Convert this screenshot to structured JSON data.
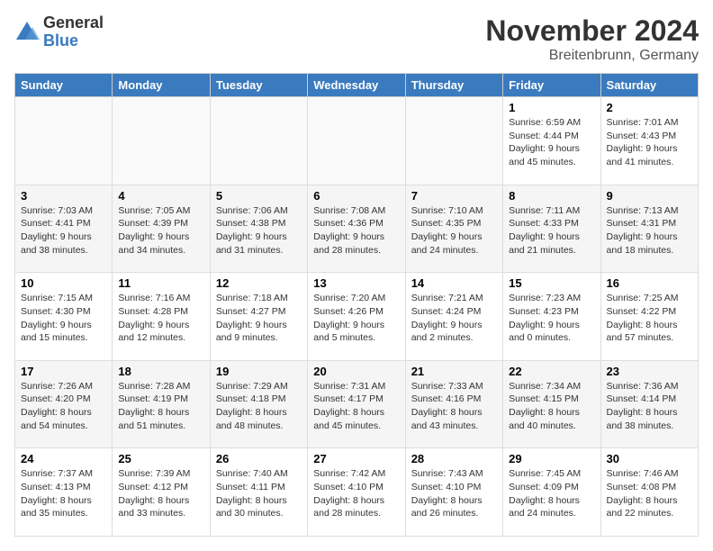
{
  "logo": {
    "general": "General",
    "blue": "Blue"
  },
  "title": "November 2024",
  "location": "Breitenbrunn, Germany",
  "days_header": [
    "Sunday",
    "Monday",
    "Tuesday",
    "Wednesday",
    "Thursday",
    "Friday",
    "Saturday"
  ],
  "weeks": [
    [
      {
        "day": "",
        "info": ""
      },
      {
        "day": "",
        "info": ""
      },
      {
        "day": "",
        "info": ""
      },
      {
        "day": "",
        "info": ""
      },
      {
        "day": "",
        "info": ""
      },
      {
        "day": "1",
        "info": "Sunrise: 6:59 AM\nSunset: 4:44 PM\nDaylight: 9 hours and 45 minutes."
      },
      {
        "day": "2",
        "info": "Sunrise: 7:01 AM\nSunset: 4:43 PM\nDaylight: 9 hours and 41 minutes."
      }
    ],
    [
      {
        "day": "3",
        "info": "Sunrise: 7:03 AM\nSunset: 4:41 PM\nDaylight: 9 hours and 38 minutes."
      },
      {
        "day": "4",
        "info": "Sunrise: 7:05 AM\nSunset: 4:39 PM\nDaylight: 9 hours and 34 minutes."
      },
      {
        "day": "5",
        "info": "Sunrise: 7:06 AM\nSunset: 4:38 PM\nDaylight: 9 hours and 31 minutes."
      },
      {
        "day": "6",
        "info": "Sunrise: 7:08 AM\nSunset: 4:36 PM\nDaylight: 9 hours and 28 minutes."
      },
      {
        "day": "7",
        "info": "Sunrise: 7:10 AM\nSunset: 4:35 PM\nDaylight: 9 hours and 24 minutes."
      },
      {
        "day": "8",
        "info": "Sunrise: 7:11 AM\nSunset: 4:33 PM\nDaylight: 9 hours and 21 minutes."
      },
      {
        "day": "9",
        "info": "Sunrise: 7:13 AM\nSunset: 4:31 PM\nDaylight: 9 hours and 18 minutes."
      }
    ],
    [
      {
        "day": "10",
        "info": "Sunrise: 7:15 AM\nSunset: 4:30 PM\nDaylight: 9 hours and 15 minutes."
      },
      {
        "day": "11",
        "info": "Sunrise: 7:16 AM\nSunset: 4:28 PM\nDaylight: 9 hours and 12 minutes."
      },
      {
        "day": "12",
        "info": "Sunrise: 7:18 AM\nSunset: 4:27 PM\nDaylight: 9 hours and 9 minutes."
      },
      {
        "day": "13",
        "info": "Sunrise: 7:20 AM\nSunset: 4:26 PM\nDaylight: 9 hours and 5 minutes."
      },
      {
        "day": "14",
        "info": "Sunrise: 7:21 AM\nSunset: 4:24 PM\nDaylight: 9 hours and 2 minutes."
      },
      {
        "day": "15",
        "info": "Sunrise: 7:23 AM\nSunset: 4:23 PM\nDaylight: 9 hours and 0 minutes."
      },
      {
        "day": "16",
        "info": "Sunrise: 7:25 AM\nSunset: 4:22 PM\nDaylight: 8 hours and 57 minutes."
      }
    ],
    [
      {
        "day": "17",
        "info": "Sunrise: 7:26 AM\nSunset: 4:20 PM\nDaylight: 8 hours and 54 minutes."
      },
      {
        "day": "18",
        "info": "Sunrise: 7:28 AM\nSunset: 4:19 PM\nDaylight: 8 hours and 51 minutes."
      },
      {
        "day": "19",
        "info": "Sunrise: 7:29 AM\nSunset: 4:18 PM\nDaylight: 8 hours and 48 minutes."
      },
      {
        "day": "20",
        "info": "Sunrise: 7:31 AM\nSunset: 4:17 PM\nDaylight: 8 hours and 45 minutes."
      },
      {
        "day": "21",
        "info": "Sunrise: 7:33 AM\nSunset: 4:16 PM\nDaylight: 8 hours and 43 minutes."
      },
      {
        "day": "22",
        "info": "Sunrise: 7:34 AM\nSunset: 4:15 PM\nDaylight: 8 hours and 40 minutes."
      },
      {
        "day": "23",
        "info": "Sunrise: 7:36 AM\nSunset: 4:14 PM\nDaylight: 8 hours and 38 minutes."
      }
    ],
    [
      {
        "day": "24",
        "info": "Sunrise: 7:37 AM\nSunset: 4:13 PM\nDaylight: 8 hours and 35 minutes."
      },
      {
        "day": "25",
        "info": "Sunrise: 7:39 AM\nSunset: 4:12 PM\nDaylight: 8 hours and 33 minutes."
      },
      {
        "day": "26",
        "info": "Sunrise: 7:40 AM\nSunset: 4:11 PM\nDaylight: 8 hours and 30 minutes."
      },
      {
        "day": "27",
        "info": "Sunrise: 7:42 AM\nSunset: 4:10 PM\nDaylight: 8 hours and 28 minutes."
      },
      {
        "day": "28",
        "info": "Sunrise: 7:43 AM\nSunset: 4:10 PM\nDaylight: 8 hours and 26 minutes."
      },
      {
        "day": "29",
        "info": "Sunrise: 7:45 AM\nSunset: 4:09 PM\nDaylight: 8 hours and 24 minutes."
      },
      {
        "day": "30",
        "info": "Sunrise: 7:46 AM\nSunset: 4:08 PM\nDaylight: 8 hours and 22 minutes."
      }
    ]
  ]
}
